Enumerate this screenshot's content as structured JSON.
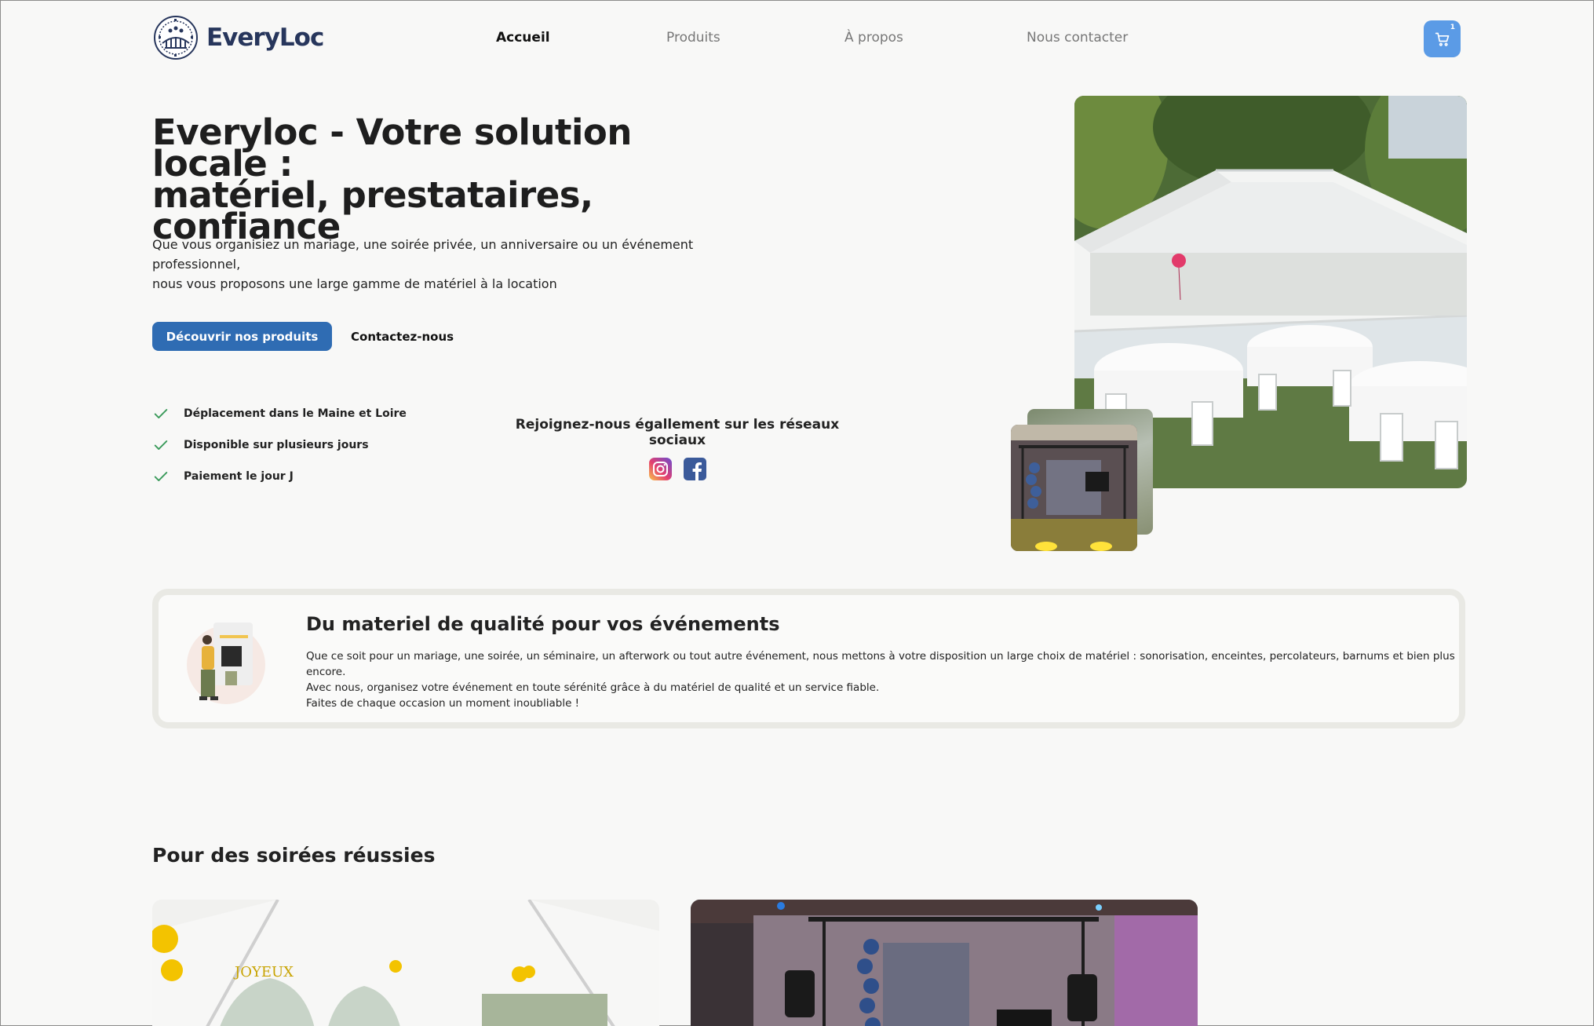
{
  "nav": {
    "logo_text": "EveryLoc",
    "links": [
      {
        "label": "Accueil",
        "active": true
      },
      {
        "label": "Produits",
        "active": false
      },
      {
        "label": "À propos",
        "active": false
      },
      {
        "label": "Nous contacter",
        "active": false
      }
    ],
    "cart_count": "1",
    "cart_icon": "cart-icon",
    "accent_color": "#5b9be6"
  },
  "hero": {
    "title_line1": "Everyloc - Votre solution locale :",
    "title_line2": "matériel, prestataires, confiance",
    "description_line1": "Que vous organisiez un mariage, une soirée privée, un anniversaire ou un événement professionnel,",
    "description_line2": "nous vous proposons une large gamme de matériel à la location",
    "primary_button": "Découvrir nos produits",
    "secondary_button": "Contactez-nous",
    "primary_color": "#2f6cb3",
    "features": [
      "Déplacement dans le Maine et Loire",
      "Disponible sur plusieurs jours",
      "Paiement le jour J"
    ],
    "social_title": "Rejoignez-nous égallement sur les réseaux sociaux",
    "social_icons": [
      "instagram-icon",
      "facebook-icon"
    ]
  },
  "quality": {
    "title": "Du materiel de qualité pour vos événements",
    "line1": " Que ce soit pour un mariage, une soirée, un séminaire, un afterwork ou tout autre événement, nous mettons à votre disposition un large choix de matériel : sonorisation, enceintes, percolateurs, barnums et bien plus encore.",
    "line2": "Avec nous, organisez votre événement en toute sérénité grâce à du matériel de qualité et un service fiable.",
    "line3": "Faites de chaque occasion un moment inoubliable !"
  },
  "section": {
    "title": "Pour des soirées réussies"
  }
}
